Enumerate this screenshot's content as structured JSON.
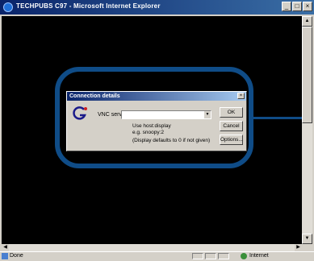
{
  "window": {
    "title": "TECHPUBS C97 - Microsoft Internet Explorer",
    "controls": {
      "minimize": "_",
      "maximize": "□",
      "close": "×"
    }
  },
  "dialog": {
    "title": "Connection details",
    "close_glyph": "×",
    "vnc_label": "VNC server:",
    "vnc_value": "",
    "combo_arrow": "▼",
    "hint_line1": "Use host:display",
    "hint_line2": "e.g. snoopy:2",
    "hint_line3": "(Display defaults to 0 if not given)",
    "ok_label": "OK",
    "cancel_label": "Cancel",
    "options_label": "Options..."
  },
  "statusbar": {
    "status_text": "Done",
    "zone_text": "Internet"
  },
  "icons": {
    "ie": "ie-logo-icon",
    "vnc": "vnc-logo-icon",
    "page": "page-icon",
    "globe": "internet-zone-icon"
  },
  "colors": {
    "annotation": "#0f4c87",
    "viewport": "#000000",
    "title_bar": "#0a246a"
  }
}
